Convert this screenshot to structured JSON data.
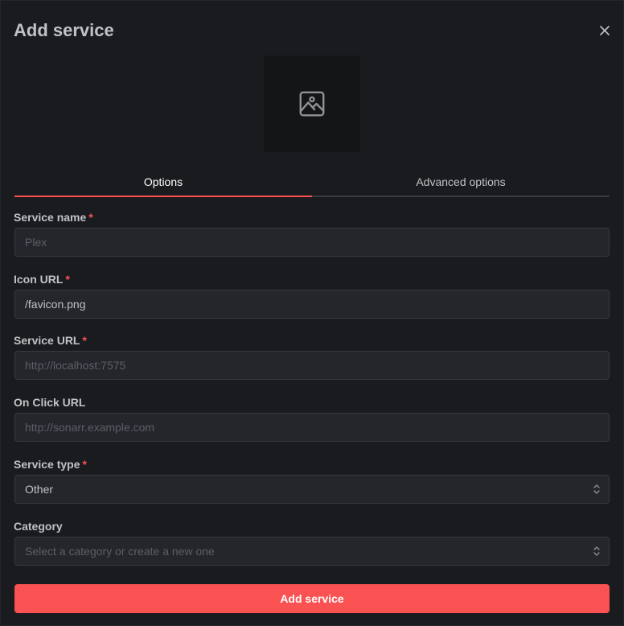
{
  "modal": {
    "title": "Add service",
    "close_icon": "close-icon"
  },
  "preview": {
    "icon": "image-placeholder-icon"
  },
  "tabs": [
    {
      "label": "Options",
      "active": true
    },
    {
      "label": "Advanced options",
      "active": false
    }
  ],
  "fields": {
    "service_name": {
      "label": "Service name",
      "required": "*",
      "value": "",
      "placeholder": "Plex"
    },
    "icon_url": {
      "label": "Icon URL",
      "required": "*",
      "value": "/favicon.png",
      "placeholder": ""
    },
    "service_url": {
      "label": "Service URL",
      "required": "*",
      "value": "",
      "placeholder": "http://localhost:7575"
    },
    "on_click_url": {
      "label": "On Click URL",
      "value": "",
      "placeholder": "http://sonarr.example.com"
    },
    "service_type": {
      "label": "Service type",
      "required": "*",
      "value": "Other"
    },
    "category": {
      "label": "Category",
      "value": "",
      "placeholder": "Select a category or create a new one"
    }
  },
  "submit_label": "Add service",
  "colors": {
    "accent": "#fa5252",
    "background": "#1a1b1e",
    "input_bg": "#25262b"
  }
}
